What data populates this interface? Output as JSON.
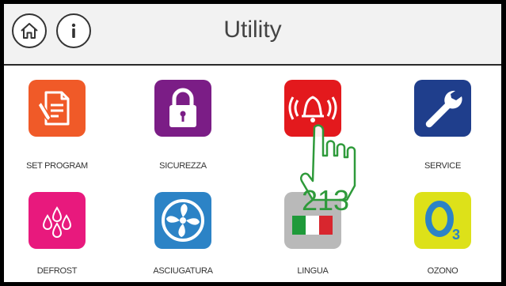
{
  "header": {
    "title": "Utility",
    "home_icon": "home-icon",
    "info_icon": "info-icon"
  },
  "tiles": [
    {
      "label": "SET PROGRAM",
      "color": "#f05a28",
      "icon": "document-pencil-icon"
    },
    {
      "label": "SICUREZZA",
      "color": "#7b1d86",
      "icon": "padlock-icon"
    },
    {
      "label": "",
      "color": "#e3191d",
      "icon": "alarm-bell-icon"
    },
    {
      "label": "SERVICE",
      "color": "#1f3e8c",
      "icon": "wrench-icon"
    },
    {
      "label": "DEFROST",
      "color": "#e8197d",
      "icon": "water-drops-icon"
    },
    {
      "label": "ASCIUGATURA",
      "color": "#2c83c6",
      "icon": "fan-icon"
    },
    {
      "label": "LINGUA",
      "color": "#b9b9b9",
      "icon": "italian-flag-icon"
    },
    {
      "label": "OZONO",
      "color": "#dde119",
      "icon": "ozone-o3-icon"
    }
  ],
  "overlay": {
    "step_number": "213",
    "hand_color": "#2e9a3a",
    "hand_icon": "tap-hand-icon"
  }
}
